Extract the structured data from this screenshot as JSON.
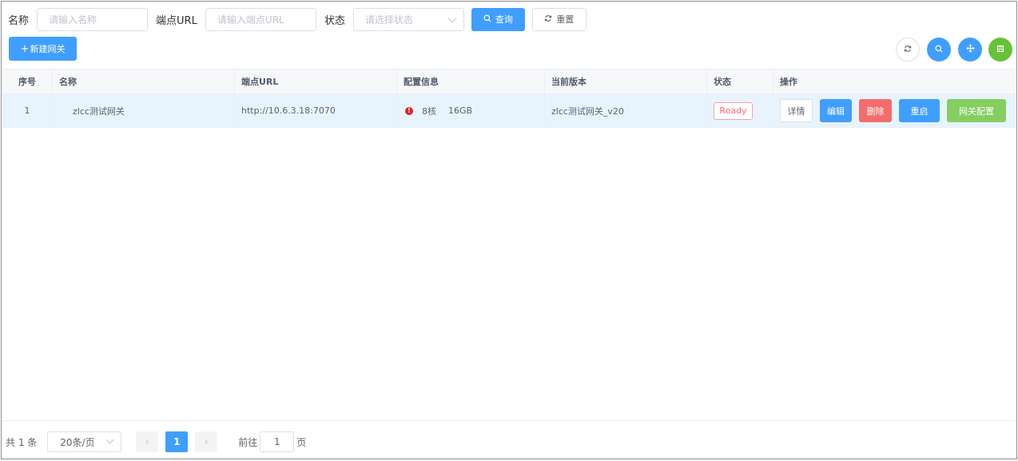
{
  "search": {
    "name_label": "名称",
    "name_placeholder": "请输入名称",
    "url_label": "端点URL",
    "url_placeholder": "请输入端点URL",
    "status_label": "状态",
    "status_placeholder": "请选择状态",
    "query_button": "查询",
    "reset_button": "重置"
  },
  "toolbar": {
    "add_button": "新建网关",
    "icons": [
      "refresh-icon",
      "search-icon",
      "move-icon",
      "save-icon"
    ],
    "colors": {
      "primary": "#409eff",
      "success": "#67c23a",
      "danger": "#f56c6c",
      "light_success": "#85ce61"
    }
  },
  "table": {
    "headers": [
      "序号",
      "名称",
      "端点URL",
      "配置信息",
      "当前版本",
      "状态",
      "操作"
    ],
    "rows": [
      {
        "index": "1",
        "name": "zlcc测试网关",
        "url": "http://10.6.3.18:7070",
        "cpu": "8核",
        "memory": "16GB",
        "version": "zlcc测试网关_v20",
        "status": "Ready",
        "actions": {
          "detail": "详情",
          "edit": "编辑",
          "delete": "删除",
          "restart": "重启",
          "config": "网关配置"
        }
      }
    ]
  },
  "pagination": {
    "total": "共 1 条",
    "page_size": "20条/页",
    "current_page": "1",
    "goto_label": "前往",
    "goto_value": "1",
    "page_suffix": "页"
  }
}
